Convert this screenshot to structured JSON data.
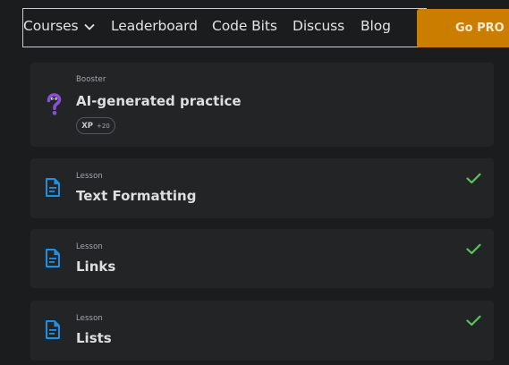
{
  "nav": {
    "items": [
      {
        "label": "Courses"
      },
      {
        "label": "Leaderboard"
      },
      {
        "label": "Code Bits"
      },
      {
        "label": "Discuss"
      },
      {
        "label": "Blog"
      }
    ],
    "cta_label": "Go PRO"
  },
  "booster": {
    "kicker": "Booster",
    "title": "AI-generated practice",
    "xp_label": "XP",
    "xp_value": "+20"
  },
  "lessons": [
    {
      "kicker": "Lesson",
      "title": "Text Formatting",
      "completed": true
    },
    {
      "kicker": "Lesson",
      "title": "Links",
      "completed": true
    },
    {
      "kicker": "Lesson",
      "title": "Lists",
      "completed": true
    }
  ],
  "colors": {
    "background": "#1b1c1e",
    "card": "#232426",
    "accent_orange": "#cb7d00",
    "lesson_icon_blue": "#1e8fe3",
    "booster_icon_purple": "#8a4fd8",
    "check_green": "#5bc35c"
  },
  "icons": {
    "dropdown": "chevron-down-icon",
    "booster": "question-mark-icon",
    "lesson": "document-icon",
    "completed": "checkmark-icon"
  }
}
